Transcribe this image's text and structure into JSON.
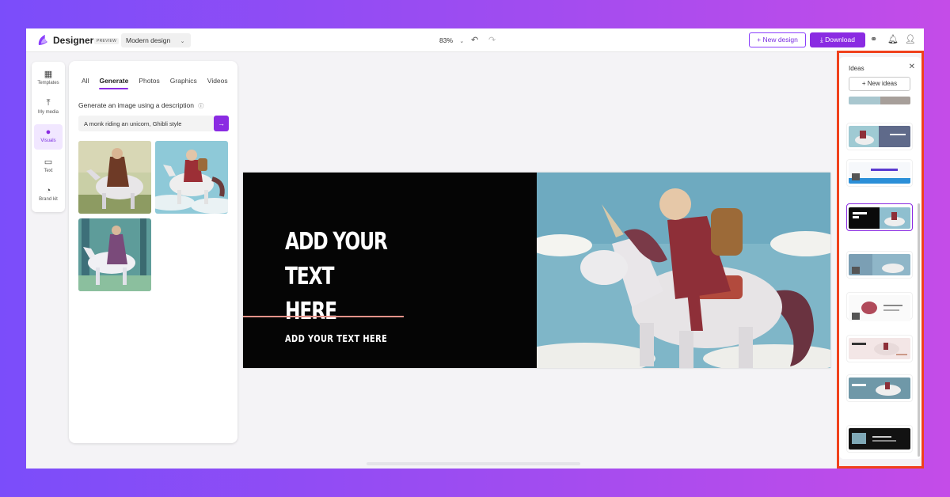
{
  "topbar": {
    "brand": "Designer",
    "badge": "PREVIEW",
    "design_type": "Modern design",
    "zoom": "83%",
    "new_design_label": "New design",
    "download_label": "Download"
  },
  "rail": {
    "items": [
      {
        "label": "Templates",
        "icon": "templates-icon"
      },
      {
        "label": "My media",
        "icon": "upload-icon"
      },
      {
        "label": "Visuals",
        "icon": "visuals-icon"
      },
      {
        "label": "Text",
        "icon": "text-icon"
      },
      {
        "label": "Brand kit",
        "icon": "brand-kit-icon"
      }
    ],
    "active": "Visuals"
  },
  "panel": {
    "tabs": [
      "All",
      "Generate",
      "Photos",
      "Graphics",
      "Videos"
    ],
    "active_tab": "Generate",
    "generate_label": "Generate an image using a description",
    "prompt_value": "A monk riding an unicorn, Ghibli style"
  },
  "canvas": {
    "headline_1": "ADD YOUR TEXT",
    "headline_2": "HERE",
    "subtext": "ADD YOUR TEXT HERE"
  },
  "ideas": {
    "title": "Ideas",
    "new_ideas_label": "New ideas"
  },
  "colors": {
    "accent": "#8a2be2",
    "highlight": "#f0411c",
    "canvas_line": "#e8938a"
  }
}
